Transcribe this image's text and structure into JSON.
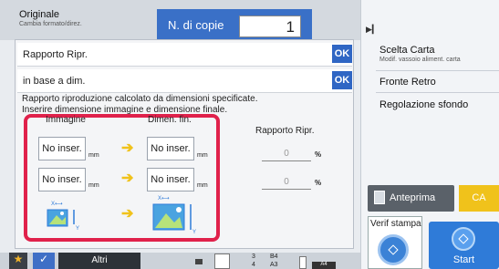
{
  "header": {
    "copies_label": "N. di copie",
    "copies_value": "1"
  },
  "right_panel": {
    "items": [
      {
        "title": "Originale",
        "subtitle": "Cambia formato/direz."
      },
      {
        "title": "Scelta Carta",
        "subtitle": "Modif. vassoio aliment. carta"
      },
      {
        "title": "Fronte Retro",
        "subtitle": ""
      },
      {
        "title": "Regolazione sfondo",
        "subtitle": ""
      }
    ],
    "preview_label": "Anteprima",
    "ca_label": "CA",
    "verif_label": "Verif stampa",
    "start_label": "Start"
  },
  "dialog": {
    "title": "Rapporto Ripr.",
    "subtitle": "in base a dim.",
    "ok_label": "OK",
    "description_line1": "Rapporto riproduzione calcolato da dimensioni specificate.",
    "description_line2": "Inserire dimensione immagine e dimensione finale.",
    "col_image": "Immagine",
    "col_final": "Dimen. fin.",
    "placeholder": "No inser.",
    "unit": "mm",
    "ratio_label": "Rapporto Ripr.",
    "ratio_values": [
      "0",
      "0"
    ],
    "percent": "%"
  },
  "bottom_bar": {
    "star": "★",
    "check": "✓",
    "altri_label": "Altri",
    "trays": [
      "3",
      "B4",
      "4",
      "A3"
    ],
    "current_paper": "A4"
  },
  "colors": {
    "accent_blue": "#2f66c4",
    "highlight_red": "#e0214b",
    "arrow_yellow": "#f0c21b",
    "ca_yellow": "#f0c21b",
    "start_blue": "#2f7bd8"
  }
}
